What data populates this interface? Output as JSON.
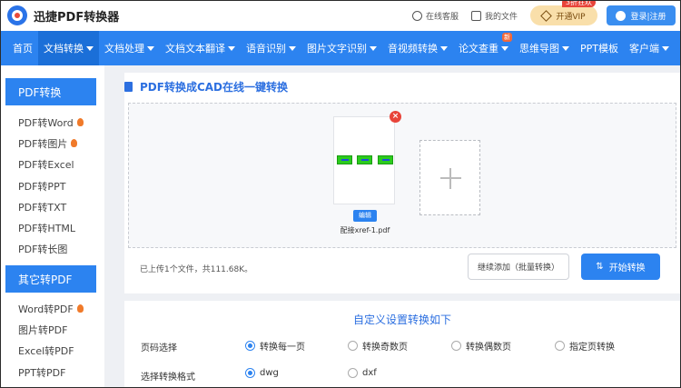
{
  "header": {
    "app_name": "迅捷PDF转换器",
    "service_label": "在线客服",
    "files_label": "我的文件",
    "vip_label": "开通VIP",
    "vip_badge": "3折狂欢",
    "login_label": "登录|注册"
  },
  "nav": {
    "items": [
      {
        "label": "首页"
      },
      {
        "label": "文档转换"
      },
      {
        "label": "文档处理"
      },
      {
        "label": "文档文本翻译"
      },
      {
        "label": "语音识别"
      },
      {
        "label": "图片文字识别"
      },
      {
        "label": "音视频转换"
      },
      {
        "label": "论文查重"
      },
      {
        "label": "思维导图"
      },
      {
        "label": "PPT模板"
      },
      {
        "label": "客户端"
      }
    ],
    "new_badge": "新"
  },
  "sidebar": {
    "section1_title": "PDF转换",
    "section1_items": [
      {
        "label": "PDF转Word"
      },
      {
        "label": "PDF转图片"
      },
      {
        "label": "PDF转Excel"
      },
      {
        "label": "PDF转PPT"
      },
      {
        "label": "PDF转TXT"
      },
      {
        "label": "PDF转HTML"
      },
      {
        "label": "PDF转长图"
      }
    ],
    "section2_title": "其它转PDF",
    "section2_items": [
      {
        "label": "Word转PDF"
      },
      {
        "label": "图片转PDF"
      },
      {
        "label": "Excel转PDF"
      },
      {
        "label": "PPT转PDF"
      }
    ]
  },
  "main": {
    "title": "PDF转换成CAD在线一键转换",
    "file": {
      "edit_label": "编辑",
      "name": "配接xref-1.pdf"
    },
    "upload_info": "已上传1个文件，共111.68K。",
    "continue_label": "继续添加（批量转换）",
    "start_label": "开始转换"
  },
  "settings": {
    "title": "自定义设置转换如下",
    "page_label": "页码选择",
    "page_options": [
      {
        "label": "转换每一页",
        "selected": true
      },
      {
        "label": "转换奇数页",
        "selected": false
      },
      {
        "label": "转换偶数页",
        "selected": false
      },
      {
        "label": "指定页转换",
        "selected": false
      }
    ],
    "format_label": "选择转换格式",
    "format_options": [
      {
        "label": "dwg",
        "selected": true
      },
      {
        "label": "dxf",
        "selected": false
      }
    ]
  },
  "colors": {
    "primary": "#2c83f0",
    "nav_active": "#1b6fd8",
    "title_blue": "#2c6fe0",
    "danger": "#e8443a",
    "vip_bg": "#f9dfaa"
  }
}
